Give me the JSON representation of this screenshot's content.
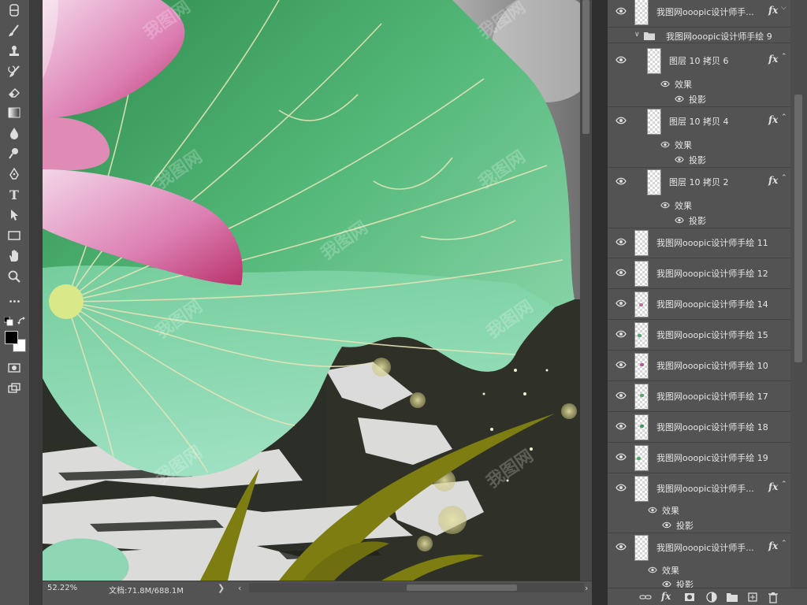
{
  "status": {
    "zoom": "52.22%",
    "doc_info": "文档:71.8M/688.1M",
    "arrow": "❯"
  },
  "toolbar": {
    "tools": [
      "spot-healing-brush-icon",
      "brush-icon",
      "clone-stamp-icon",
      "history-brush-icon",
      "eraser-icon",
      "gradient-icon",
      "blur-icon",
      "dodge-icon",
      "pen-icon",
      "type-icon",
      "path-selection-icon",
      "rectangle-icon",
      "hand-icon",
      "zoom-icon",
      "more-tools-icon"
    ],
    "type_glyph": "T",
    "more_glyph": "•••"
  },
  "layers": {
    "top_layer": "我图网ooopic设计师手...",
    "group": "我图网ooopic设计师手绘 9",
    "copy6": "图层 10 拷贝 6",
    "copy4": "图层 10 拷贝 4",
    "copy2": "图层 10 拷贝 2",
    "effects_label": "效果",
    "shadow_label": "投影",
    "fx": "fx",
    "l11": "我图网ooopic设计师手绘 11",
    "l12": "我图网ooopic设计师手绘 12",
    "l14": "我图网ooopic设计师手绘 14",
    "l15": "我图网ooopic设计师手绘 15",
    "l10": "我图网ooopic设计师手绘 10",
    "l17": "我图网ooopic设计师手绘 17",
    "l18": "我图网ooopic设计师手绘 18",
    "l19": "我图网ooopic设计师手绘 19",
    "trunc_a": "我图网ooopic设计师手...",
    "trunc_b": "我图网ooopic设计师手..."
  },
  "canvas": {
    "watermark": "我图网"
  },
  "footer": {
    "fx": "fx"
  },
  "colors": {
    "foreground": "#000000",
    "background": "#ffffff"
  }
}
